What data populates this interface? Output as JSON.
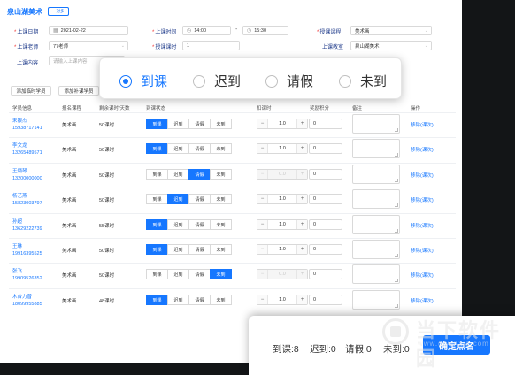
{
  "header": {
    "title": "泉山湖美术",
    "tag": "一对多"
  },
  "form": {
    "date_label": "上课日期",
    "date_value": "2021-02-22",
    "time_label": "上课时间",
    "time_start": "14:00",
    "time_end": "15:30",
    "course_label": "授课课程",
    "course_value": "美术画",
    "teacher_label": "上课老师",
    "teacher_value": "77老师",
    "hours_label": "授课课时",
    "hours_value": "1",
    "room_label": "上课教室",
    "room_value": "泉山湖美术",
    "content_label": "上课内容",
    "content_placeholder": "请输入上课内容"
  },
  "actions": {
    "add_temp": "添加临时学员",
    "add_makeup": "添加补课学员"
  },
  "table": {
    "headers": [
      "学员信息",
      "报名课程",
      "剩余课时/天数",
      "到课状态",
      "扣课时",
      "奖励积分",
      "备注",
      "操作"
    ],
    "status_options": [
      "到课",
      "迟到",
      "请假",
      "未到"
    ],
    "rows": [
      {
        "name": "宋银杰",
        "phone": "15938717141",
        "course": "美术画",
        "remain": "50课时",
        "status": 0,
        "deduct": "1.0",
        "points": "0",
        "op": "移除(课次)"
      },
      {
        "name": "李文龙",
        "phone": "13265489571",
        "course": "美术画",
        "remain": "50课时",
        "status": 0,
        "deduct": "1.0",
        "points": "0",
        "op": "移除(课次)"
      },
      {
        "name": "王炳琴",
        "phone": "13200000000",
        "course": "美术画",
        "remain": "50课时",
        "status": 2,
        "deduct": "0.0",
        "points": "0",
        "op": "移除(课次)"
      },
      {
        "name": "杨艺燕",
        "phone": "15823003797",
        "course": "美术画",
        "remain": "50课时",
        "status": 1,
        "deduct": "1.0",
        "points": "0",
        "op": "移除(课次)"
      },
      {
        "name": "孙超",
        "phone": "13629222739",
        "course": "美术画",
        "remain": "55课时",
        "status": 0,
        "deduct": "1.0",
        "points": "0",
        "op": "移除(课次)"
      },
      {
        "name": "王琳",
        "phone": "19916395525",
        "course": "美术画",
        "remain": "50课时",
        "status": 0,
        "deduct": "1.0",
        "points": "0",
        "op": "移除(课次)"
      },
      {
        "name": "张飞",
        "phone": "19909526352",
        "course": "美术画",
        "remain": "50课时",
        "status": 3,
        "deduct": "0.0",
        "points": "0",
        "op": "移除(课次)"
      },
      {
        "name": "木台力普",
        "phone": "18099955885",
        "course": "美术画",
        "remain": "48课时",
        "status": 0,
        "deduct": "1.0",
        "points": "0",
        "op": "移除(课次)"
      }
    ]
  },
  "overlay": {
    "options": [
      "到课",
      "迟到",
      "请假",
      "未到"
    ],
    "selected": 0
  },
  "footer": {
    "arrived": "到课:8",
    "late": "迟到:0",
    "leave": "请假:0",
    "absent": "未到:0",
    "confirm": "确定点名"
  },
  "watermark": {
    "text": "当下软件园",
    "url": "www.downxia.com"
  },
  "colors": {
    "accent": "#1677ff",
    "background": "#131517",
    "label": "#1e3a8a"
  }
}
